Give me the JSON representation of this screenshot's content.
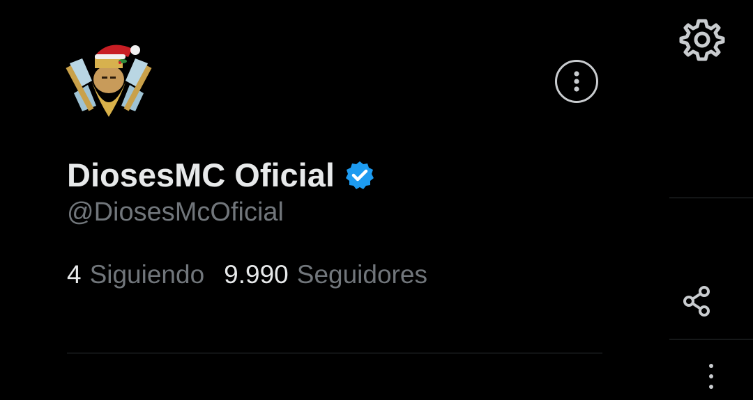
{
  "profile": {
    "display_name": "DiosesMC Oficial",
    "handle": "@DiosesMcOficial",
    "following_count": "4",
    "following_label": "Siguiendo",
    "followers_count": "9.990",
    "followers_label": "Seguidores",
    "verified": true
  },
  "icons": {
    "avatar": "avatar-logo-icon",
    "more": "more-options-icon",
    "settings": "gear-icon",
    "verified": "verified-badge-icon",
    "share": "share-icon",
    "vertical_more": "vertical-more-icon"
  },
  "colors": {
    "background": "#000000",
    "primary_text": "#e7e9ea",
    "secondary_text": "#71767b",
    "verified_blue": "#1d9bf0",
    "divider": "#2f3336"
  }
}
